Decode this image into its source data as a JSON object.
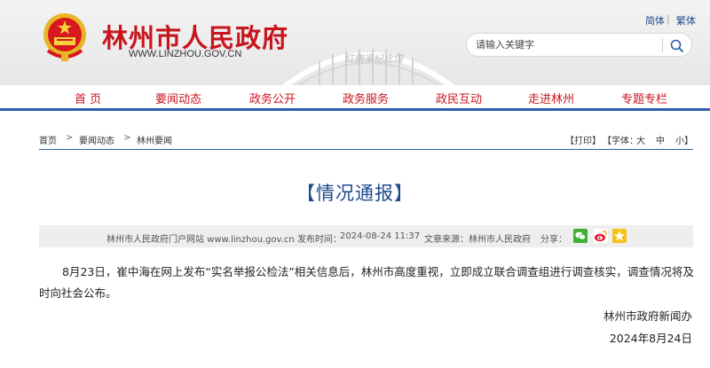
{
  "header": {
    "site_title": "林州市人民政府",
    "site_url": "WWW.LINZHOU.GOV.CN",
    "lang_simplified": "简体",
    "lang_separator": "|",
    "lang_traditional": "繁体",
    "search_placeholder": "请输入关键字",
    "building_inscription": "红旗渠纪念馆",
    "emblem_icon": "national-emblem-icon",
    "search_icon": "search-icon"
  },
  "nav": {
    "items": [
      "首 页",
      "要闻动态",
      "政务公开",
      "政务服务",
      "政民互动",
      "走进林州",
      "专题专栏"
    ]
  },
  "breadcrumb": {
    "items": [
      "首页",
      "要闻动态",
      "林州要闻"
    ],
    "separator": ">"
  },
  "tools": {
    "print": "【打印】",
    "font_label": "【字体：",
    "font_large": "大",
    "font_medium": "中",
    "font_small": "小",
    "close_bracket": "】"
  },
  "article": {
    "title": "【情况通报】",
    "source_site": "林州市人民政府门户网站 www.linzhou.gov.cn",
    "publish_label": "发布时间：",
    "publish_time": "2024-08-24 11:37",
    "origin_label": "文章来源：",
    "origin": "林州市人民政府",
    "share_label": "分享：",
    "share_icons": [
      "wechat-icon",
      "weibo-icon",
      "qzone-icon"
    ],
    "body": "8月23日，崔中海在网上发布“实名举报公检法”相关信息后，林州市高度重视，立即成立联合调查组进行调查核实，调查情况将及时向社会公布。",
    "signature_org": "林州市政府新闻办",
    "signature_date": "2024年8月24日"
  },
  "colors": {
    "brand_red": "#c8151d",
    "nav_blue": "#2c5fa8",
    "title_blue": "#1f4b8c",
    "meta_bg": "#eeeeee"
  }
}
